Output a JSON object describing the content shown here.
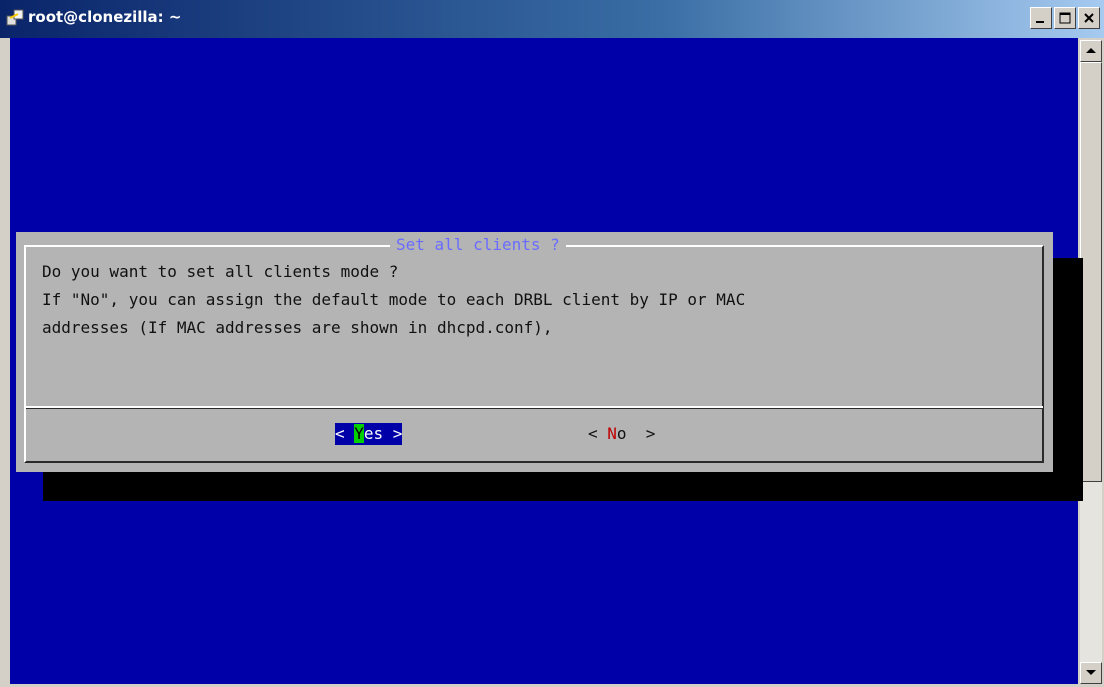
{
  "window": {
    "title": "root@clonezilla: ~"
  },
  "dialog": {
    "title": "Set all clients ?",
    "lines": [
      "Do you want to set all clients mode ?",
      "If \"No\", you can assign the default mode to each DRBL client by IP or MAC",
      "addresses (If MAC addresses are shown in dhcpd.conf),"
    ],
    "yes_button": {
      "left": "< ",
      "hotkey": "Y",
      "rest": "es >"
    },
    "no_button": {
      "left": "< ",
      "hotkey": "N",
      "rest": "o  >"
    }
  },
  "colors": {
    "terminal_bg": "#0000a8",
    "dialog_bg": "#b4b4b4",
    "title_color": "#6a6cff",
    "hotkey_green": "#00d000",
    "hotkey_red": "#c00000"
  },
  "icons": {
    "app": "putty-icon",
    "minimize": "minimize-icon",
    "maximize": "maximize-icon",
    "close": "close-icon",
    "scroll_up": "arrow-up-icon",
    "scroll_down": "arrow-down-icon"
  }
}
